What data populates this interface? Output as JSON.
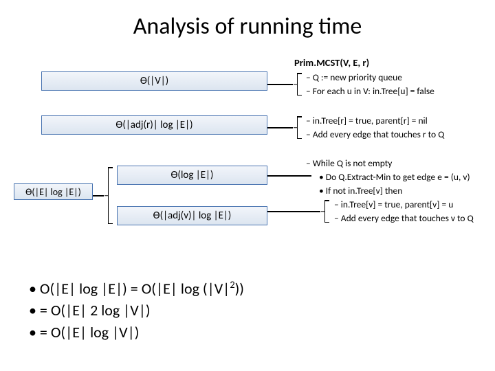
{
  "title": "Analysis of running time",
  "algo": {
    "header": "Prim.MCST(V, E, r)",
    "g1a": "– Q := new priority queue",
    "g1b": "– For each u in V: in.Tree[u] = false",
    "g2a": "– in.Tree[r] = true, parent[r] = nil",
    "g2b": "– Add every edge that touches r to Q",
    "g3": "– While Q is not empty",
    "g3a": "• Do Q.Extract-Min to get edge e = (u, v)",
    "g3b": "• If not in.Tree[v] then",
    "g3c": "– in.Tree[v] = true, parent[v] = u",
    "g3d": "– Add every edge that touches v to Q"
  },
  "boxes": {
    "b1": "ϴ(|V|)",
    "b2": "ϴ(|adj(r)| log |E|)",
    "b3": "ϴ(log |E|)",
    "b4": "ϴ(|adj(v)| log |E|)",
    "side": "ϴ(|E| log |E|)"
  },
  "bullets": {
    "l1": "• O(|E| log |E|) = O(|E| log (|V|²))",
    "l2": "• = O(|E| 2 log |V|)",
    "l3": "• = O(|E| log |V|)"
  }
}
